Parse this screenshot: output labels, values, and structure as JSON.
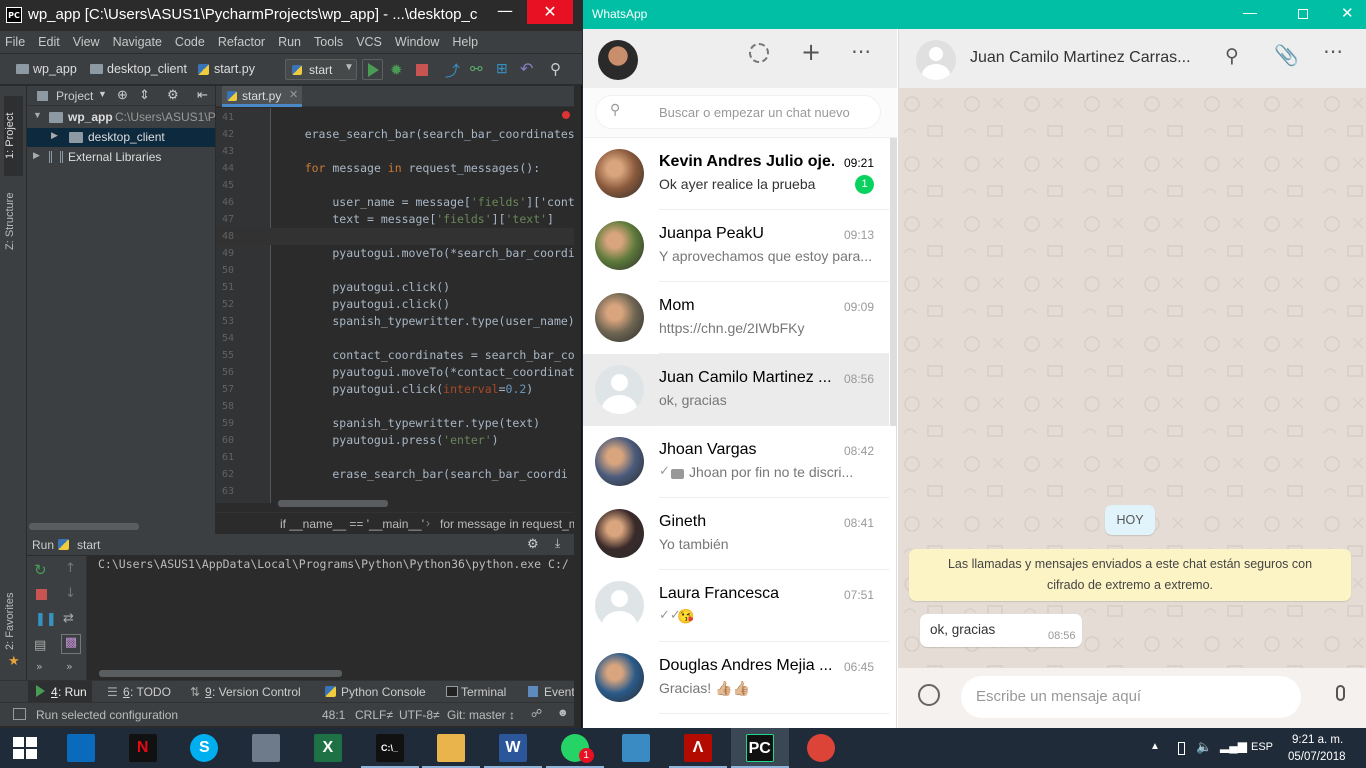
{
  "pycharm": {
    "title_icon": "PC",
    "title": "wp_app [C:\\Users\\ASUS1\\PycharmProjects\\wp_app] - ...\\desktop_c...",
    "menu": [
      "File",
      "Edit",
      "View",
      "Navigate",
      "Code",
      "Refactor",
      "Run",
      "Tools",
      "VCS",
      "Window",
      "Help"
    ],
    "breadcrumbs": [
      "wp_app",
      "desktop_client",
      "start.py"
    ],
    "run_config": "start",
    "side_tabs": {
      "project": "1: Project",
      "structure": "Z: Structure",
      "favorites": "2: Favorites"
    },
    "project_panel": {
      "header": "Project",
      "items": [
        {
          "label": "wp_app",
          "detail": "C:\\Users\\ASUS1\\Py",
          "icon": "folder-icon"
        },
        {
          "label": "desktop_client",
          "icon": "folder-icon"
        },
        {
          "label": "External Libraries",
          "icon": "library-icon"
        }
      ]
    },
    "editor_tab": "start.py",
    "code_lines": [
      {
        "n": "41",
        "text": ""
      },
      {
        "n": "42",
        "text": "    erase_search_bar(search_bar_coordinates"
      },
      {
        "n": "43",
        "text": ""
      },
      {
        "n": "44",
        "text": "    for message in request_messages():"
      },
      {
        "n": "45",
        "text": ""
      },
      {
        "n": "46",
        "text": "        user_name = message['fields']['cont"
      },
      {
        "n": "47",
        "text": "        text = message['fields']['text']"
      },
      {
        "n": "48",
        "text": ""
      },
      {
        "n": "49",
        "text": "        pyautogui.moveTo(*search_bar_coordi"
      },
      {
        "n": "50",
        "text": ""
      },
      {
        "n": "51",
        "text": "        pyautogui.click()"
      },
      {
        "n": "52",
        "text": "        pyautogui.click()"
      },
      {
        "n": "53",
        "text": "        spanish_typewritter.type(user_name)"
      },
      {
        "n": "54",
        "text": ""
      },
      {
        "n": "55",
        "text": "        contact_coordinates = search_bar_co"
      },
      {
        "n": "56",
        "text": "        pyautogui.moveTo(*contact_coordinat"
      },
      {
        "n": "57",
        "text": "        pyautogui.click(interval=0.2)"
      },
      {
        "n": "58",
        "text": ""
      },
      {
        "n": "59",
        "text": "        spanish_typewritter.type(text)"
      },
      {
        "n": "60",
        "text": "        pyautogui.press('enter')"
      },
      {
        "n": "61",
        "text": ""
      },
      {
        "n": "62",
        "text": "        erase_search_bar(search_bar_coordi"
      },
      {
        "n": "63",
        "text": ""
      }
    ],
    "editor_breadcrumb": [
      "if __name__ == '__main__'",
      "for message in request_m"
    ],
    "run_panel": {
      "label": "Run",
      "config": "start",
      "output": "C:\\Users\\ASUS1\\AppData\\Local\\Programs\\Python\\Python36\\python.exe C:/"
    },
    "bottom_tabs": [
      {
        "num": "4",
        "label": ": Run"
      },
      {
        "num": "6",
        "label": ": TODO"
      },
      {
        "num": "9",
        "label": ": Version Control"
      },
      {
        "num": "",
        "label": "Python Console"
      },
      {
        "num": "",
        "label": "Terminal"
      },
      {
        "num": "",
        "label": "Event"
      }
    ],
    "status": {
      "message": "Run selected configuration",
      "position": "48:1",
      "line_sep": "CRLF≠",
      "encoding": "UTF-8≠",
      "git": "Git: master ↕"
    }
  },
  "whatsapp": {
    "title": "WhatsApp",
    "search_placeholder": "Buscar o empezar un chat nuevo",
    "chats": [
      {
        "name": "Kevin Andres Julio oje...",
        "time": "09:21",
        "preview": "Ok ayer realice la prueba",
        "unread": "1",
        "avatar": "#8a5a3c",
        "time_color": "#000000"
      },
      {
        "name": "Juanpa PeakU",
        "time": "09:13",
        "preview": "Y aprovechamos que estoy para...",
        "avatar": "#5d7a3a"
      },
      {
        "name": "Mom",
        "time": "09:09",
        "preview": "https://chn.ge/2IWbFKy",
        "avatar": "#6e6552"
      },
      {
        "name": "Juan Camilo Martinez ...",
        "time": "08:56",
        "preview": "ok, gracias",
        "avatar": "default",
        "selected": true
      },
      {
        "name": "Jhoan Vargas",
        "time": "08:42",
        "preview": "Jhoan por fin no te discri...",
        "avatar": "#4a5b7c",
        "ticks": "✓",
        "camera": true
      },
      {
        "name": "Gineth",
        "time": "08:41",
        "preview": "Yo también",
        "avatar": "#3a2a2a"
      },
      {
        "name": "Laura Francesca",
        "time": "07:51",
        "preview": "😘",
        "avatar": "default",
        "ticks": "✓✓"
      },
      {
        "name": "Douglas Andres Mejia ...",
        "time": "06:45",
        "preview": "Gracias! 👍🏼👍🏼",
        "avatar": "#2a5a8a"
      }
    ],
    "chat_title": "Juan Camilo Martinez Carras...",
    "day_label": "HOY",
    "encryption_notice": "Las llamadas y mensajes enviados a este chat están seguros con cifrado de extremo a extremo.",
    "messages": [
      {
        "text": "ok, gracias",
        "time": "08:56"
      }
    ],
    "compose_placeholder": "Escribe un mensaje aquí",
    "unread_color": "#09d261",
    "header_color": "#00bfa5"
  },
  "taskbar": {
    "apps": [
      {
        "name": "intel-graphics-icon"
      },
      {
        "name": "netflix-icon",
        "glyph": "N"
      },
      {
        "name": "skype-icon",
        "glyph": "S"
      },
      {
        "name": "calculator-icon"
      },
      {
        "name": "excel-icon",
        "glyph": "X"
      },
      {
        "name": "cmd-icon",
        "glyph": "C:\\_"
      },
      {
        "name": "file-explorer-icon"
      },
      {
        "name": "word-icon",
        "glyph": "W"
      },
      {
        "name": "whatsapp-icon",
        "badge": "1"
      },
      {
        "name": "photos-icon"
      },
      {
        "name": "acrobat-icon",
        "glyph": "Λ"
      },
      {
        "name": "pycharm-icon",
        "glyph": "PC"
      },
      {
        "name": "chrome-icon"
      }
    ],
    "lang": "ESP",
    "time": "9:21 a. m.",
    "date": "05/07/2018"
  }
}
